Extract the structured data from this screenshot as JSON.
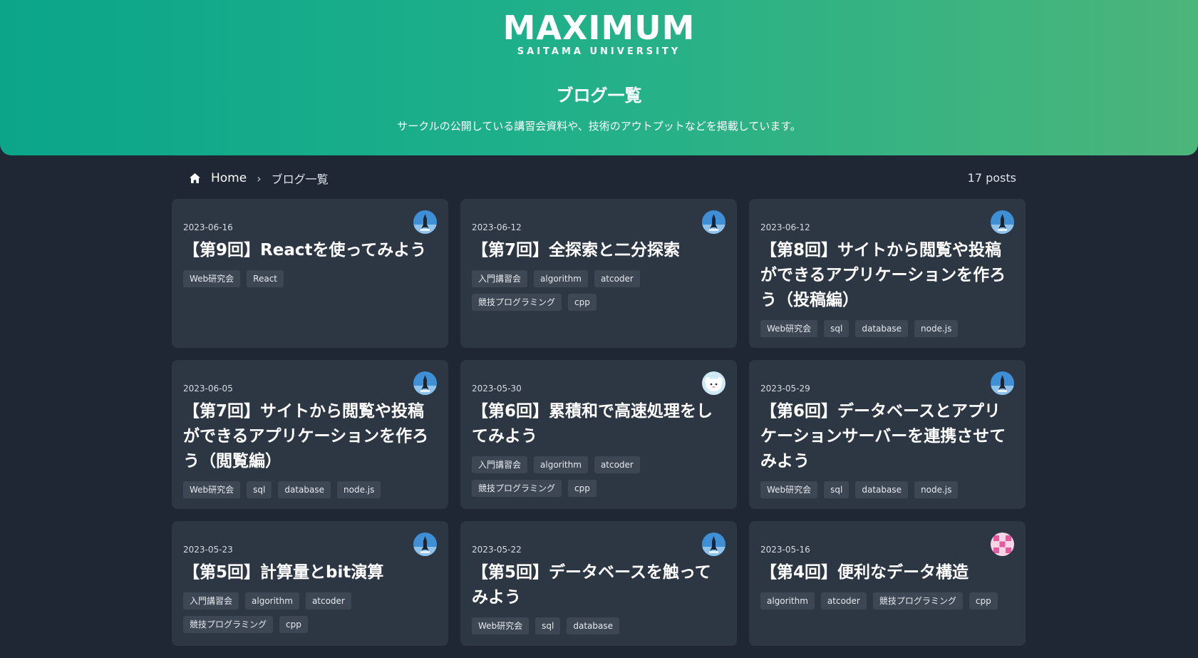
{
  "header": {
    "logo_text": "MAXIMUM",
    "logo_sub": "SAITAMA UNIVERSITY",
    "title": "ブログ一覧",
    "description": "サークルの公開している講習会資料や、技術のアウトプットなどを掲載しています。"
  },
  "breadcrumb": {
    "home": "Home",
    "separator": "›",
    "current": "ブログ一覧"
  },
  "posts_count": "17 posts",
  "posts": [
    {
      "date": "2023-06-16",
      "title": "【第9回】Reactを使ってみよう",
      "tags": [
        "Web研究会",
        "React"
      ],
      "avatar": "rocket-avatar"
    },
    {
      "date": "2023-06-12",
      "title": "【第7回】全探索と二分探索",
      "tags": [
        "入門講習会",
        "algorithm",
        "atcoder",
        "競技プログラミング",
        "cpp"
      ],
      "avatar": "rocket-avatar"
    },
    {
      "date": "2023-06-12",
      "title": "【第8回】サイトから閲覧や投稿ができるアプリケーションを作ろう（投稿編）",
      "tags": [
        "Web研究会",
        "sql",
        "database",
        "node.js"
      ],
      "avatar": "rocket-avatar"
    },
    {
      "date": "2023-06-05",
      "title": "【第7回】サイトから閲覧や投稿ができるアプリケーションを作ろう（閲覧編）",
      "tags": [
        "Web研究会",
        "sql",
        "database",
        "node.js"
      ],
      "avatar": "rocket-avatar"
    },
    {
      "date": "2023-05-30",
      "title": "【第6回】累積和で高速処理をしてみよう",
      "tags": [
        "入門講習会",
        "algorithm",
        "atcoder",
        "競技プログラミング",
        "cpp"
      ],
      "avatar": "character-avatar"
    },
    {
      "date": "2023-05-29",
      "title": "【第6回】データベースとアプリケーションサーバーを連携させてみよう",
      "tags": [
        "Web研究会",
        "sql",
        "database",
        "node.js"
      ],
      "avatar": "rocket-avatar"
    },
    {
      "date": "2023-05-23",
      "title": "【第5回】計算量とbit演算",
      "tags": [
        "入門講習会",
        "algorithm",
        "atcoder",
        "競技プログラミング",
        "cpp"
      ],
      "avatar": "rocket-avatar"
    },
    {
      "date": "2023-05-22",
      "title": "【第5回】データベースを触ってみよう",
      "tags": [
        "Web研究会",
        "sql",
        "database"
      ],
      "avatar": "rocket-avatar"
    },
    {
      "date": "2023-05-16",
      "title": "【第4回】便利なデータ構造",
      "tags": [
        "algorithm",
        "atcoder",
        "競技プログラミング",
        "cpp"
      ],
      "avatar": "pattern-avatar"
    }
  ],
  "colors": {
    "header_gradient_start": "#0ba58a",
    "header_gradient_end": "#4cb57a",
    "page_background": "#1e2733",
    "card_background": "#2d3743",
    "tag_background": "#3d4753"
  }
}
